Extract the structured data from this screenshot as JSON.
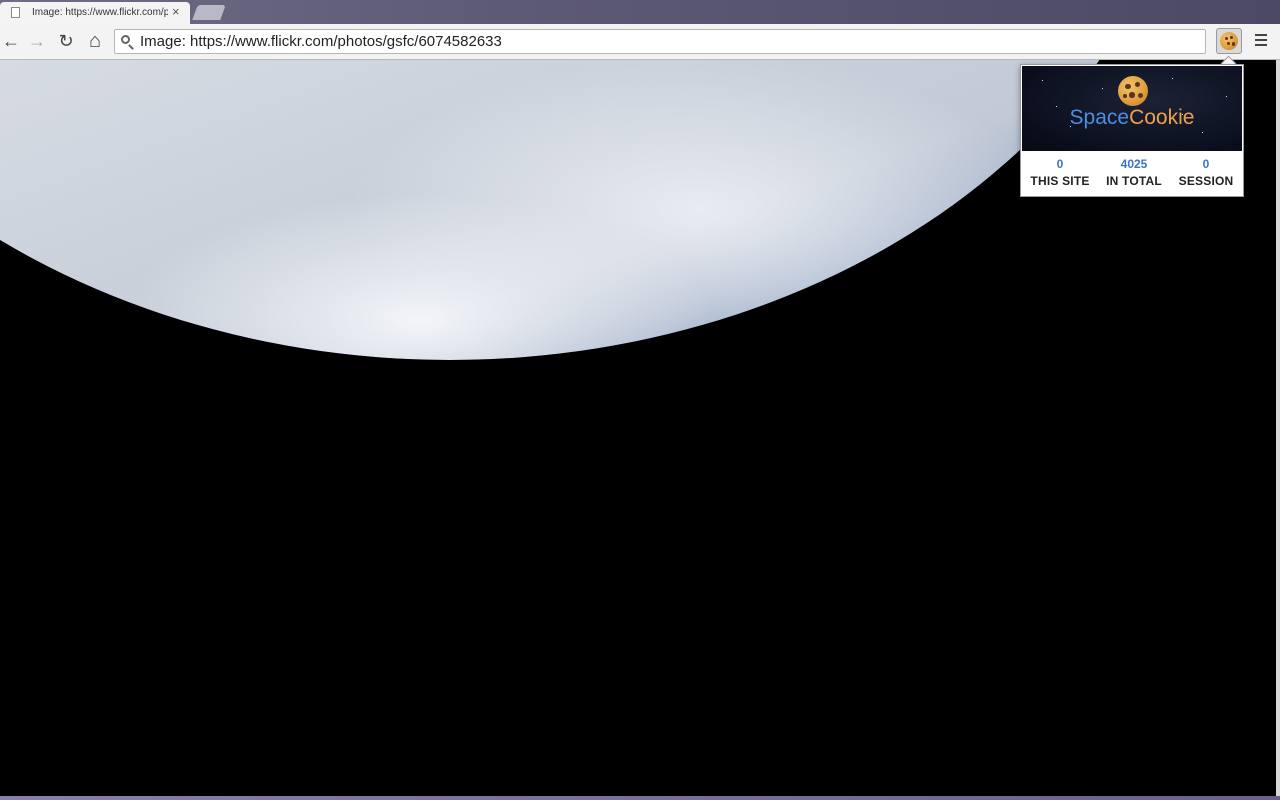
{
  "browser": {
    "tabs": [
      {
        "title": "Image: https://www.flickr.com/photos/gsfc/6074582633",
        "active": true
      }
    ],
    "tab_close_glyph": "×",
    "address_bar": {
      "value": "Image: https://www.flickr.com/photos/gsfc/6074582633"
    },
    "nav": {
      "back_glyph": "←",
      "forward_glyph": "→",
      "reload_glyph": "↻",
      "home_glyph": "⌂"
    }
  },
  "extension_popup": {
    "brand_part1": "Space",
    "brand_part2": "Cookie",
    "stats": [
      {
        "value": "0",
        "label": "THIS SITE"
      },
      {
        "value": "4025",
        "label": "IN TOTAL"
      },
      {
        "value": "0",
        "label": "SESSION"
      }
    ]
  },
  "colors": {
    "brand_blue": "#4a8fe0",
    "brand_orange": "#f0a04a",
    "stat_number": "#3a74c4"
  },
  "icons": [
    "page-icon",
    "close-icon",
    "back-arrow-icon",
    "forward-arrow-icon",
    "reload-icon",
    "home-icon",
    "search-icon",
    "cookie-icon",
    "menu-icon"
  ]
}
